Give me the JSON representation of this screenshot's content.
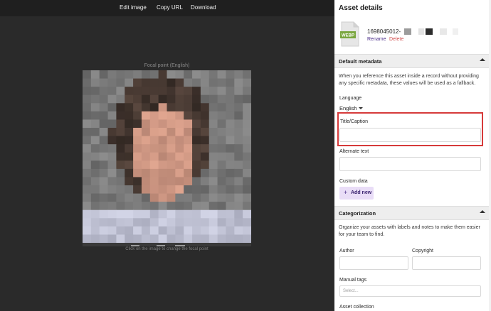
{
  "toolbar": {
    "edit_image": "Edit image",
    "copy_url": "Copy URL",
    "download": "Download"
  },
  "viewer": {
    "focal_point_label": "Focal point (English)",
    "hint": "Click on the image to change the focal point"
  },
  "panel": {
    "title": "Asset details",
    "file": {
      "type_badge": "WEBP",
      "name": "1698045012-",
      "rename": "Rename",
      "delete": "Delete"
    },
    "default_metadata": {
      "title": "Default metadata",
      "description": "When you reference this asset inside a record without providing any specific metadata, these values will be used as a fallback.",
      "language_label": "Language",
      "language_value": "English",
      "title_caption_label": "Title/Caption",
      "title_caption_value": "",
      "alt_text_label": "Alternate text",
      "alt_text_value": "",
      "custom_data_label": "Custom data",
      "add_new": "Add new"
    },
    "categorization": {
      "title": "Categorization",
      "description": "Organize your assets with labels and notes to make them easier for your team to find.",
      "author_label": "Author",
      "copyright_label": "Copyright",
      "manual_tags_label": "Manual tags",
      "manual_tags_placeholder": "Select...",
      "asset_collection_label": "Asset collection"
    }
  },
  "colors": {
    "accent": "#4a2d8a",
    "delete": "#d04a4a",
    "webp_badge": "#7aa63f",
    "highlight": "#d63a3a"
  }
}
